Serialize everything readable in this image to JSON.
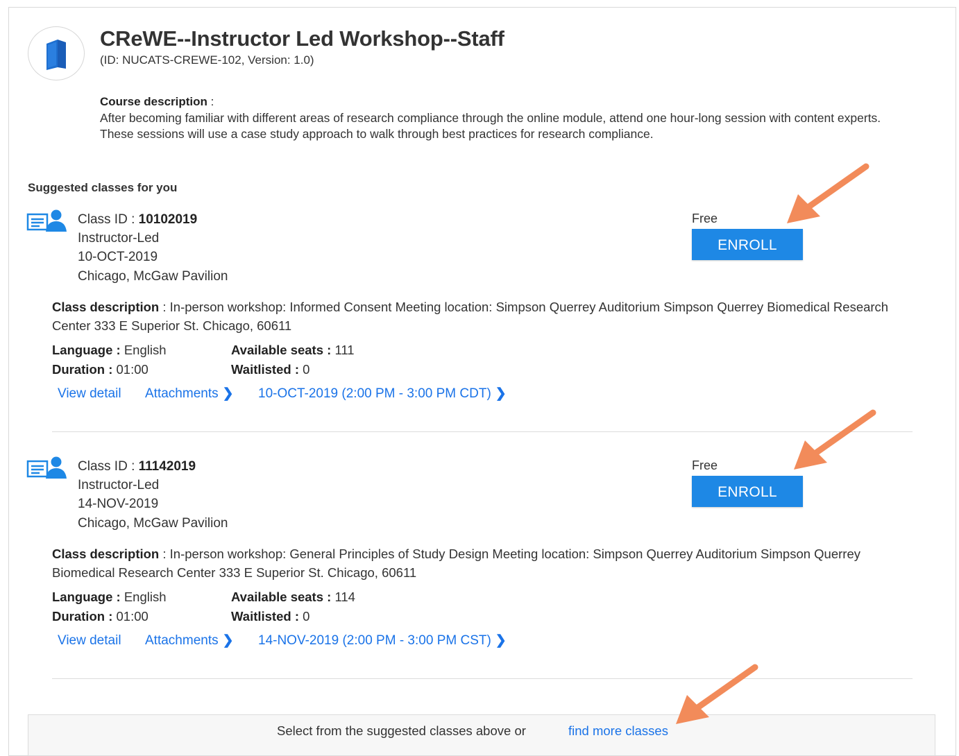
{
  "course": {
    "title": "CReWE--Instructor Led Workshop--Staff",
    "id_version": "(ID: NUCATS-CREWE-102, Version: 1.0)",
    "description_label": "Course description",
    "description_sep": " :",
    "description": "After becoming familiar with different areas of research compliance through the online module, attend one hour-long session with content experts. These sessions will use a case study approach to walk through best practices for research compliance."
  },
  "suggested_heading": "Suggested classes for you",
  "labels": {
    "class_id": "Class ID : ",
    "class_description": "Class description",
    "language": "Language : ",
    "duration": "Duration : ",
    "available_seats": "Available seats : ",
    "waitlisted": "Waitlisted : ",
    "view_detail": "View detail",
    "attachments": "Attachments"
  },
  "classes": [
    {
      "id": "10102019",
      "type": "Instructor-Led",
      "date": "10-OCT-2019",
      "location": "Chicago, McGaw Pavilion",
      "price": "Free",
      "enroll": "ENROLL",
      "description": " : In-person workshop: Informed Consent Meeting location: Simpson Querrey Auditorium Simpson Querrey Biomedical Research Center 333 E Superior St. Chicago, 60611",
      "language": "English",
      "duration": "01:00",
      "available_seats": "111",
      "waitlisted": "0",
      "session": "10-OCT-2019 (2:00 PM - 3:00 PM CDT)"
    },
    {
      "id": "11142019",
      "type": "Instructor-Led",
      "date": "14-NOV-2019",
      "location": "Chicago, McGaw Pavilion",
      "price": "Free",
      "enroll": "ENROLL",
      "description": " : In-person workshop: General Principles of Study Design Meeting location: Simpson Querrey Auditorium Simpson Querrey Biomedical Research Center 333 E Superior St. Chicago, 60611",
      "language": "English",
      "duration": "01:00",
      "available_seats": "114",
      "waitlisted": "0",
      "session": "14-NOV-2019 (2:00 PM - 3:00 PM CST)"
    }
  ],
  "footer": {
    "text": "Select from the suggested classes above or",
    "link": "find more classes"
  },
  "colors": {
    "accent": "#1e88e5",
    "link": "#1a73e8",
    "annotation_arrow": "#f28b5a"
  },
  "icons": {
    "course": "book-icon",
    "class": "instructor-class-icon",
    "chevron": "chevron-right-icon"
  }
}
